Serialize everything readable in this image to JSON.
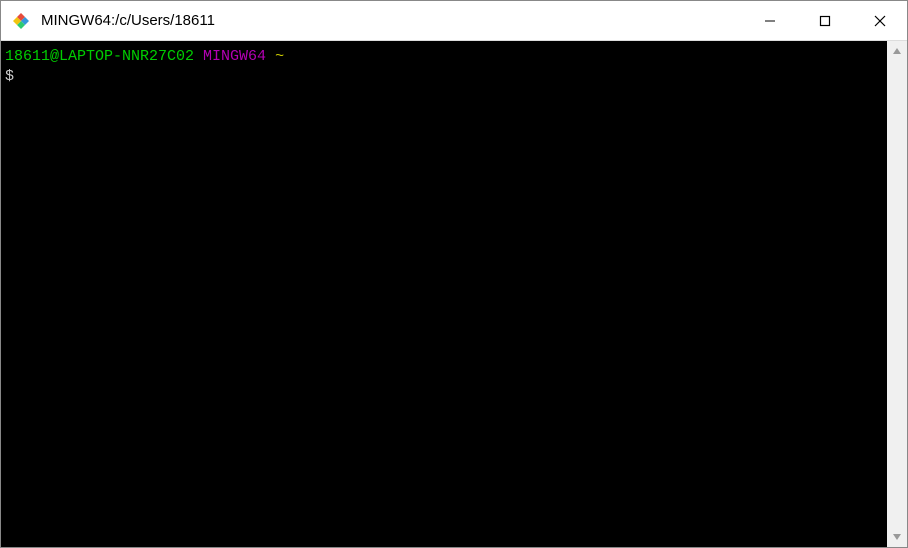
{
  "titlebar": {
    "title": "MINGW64:/c/Users/18611"
  },
  "terminal": {
    "prompt_user_host": "18611@LAPTOP-NNR27C02",
    "prompt_env": "MINGW64",
    "prompt_path": "~",
    "prompt_symbol": "$"
  }
}
